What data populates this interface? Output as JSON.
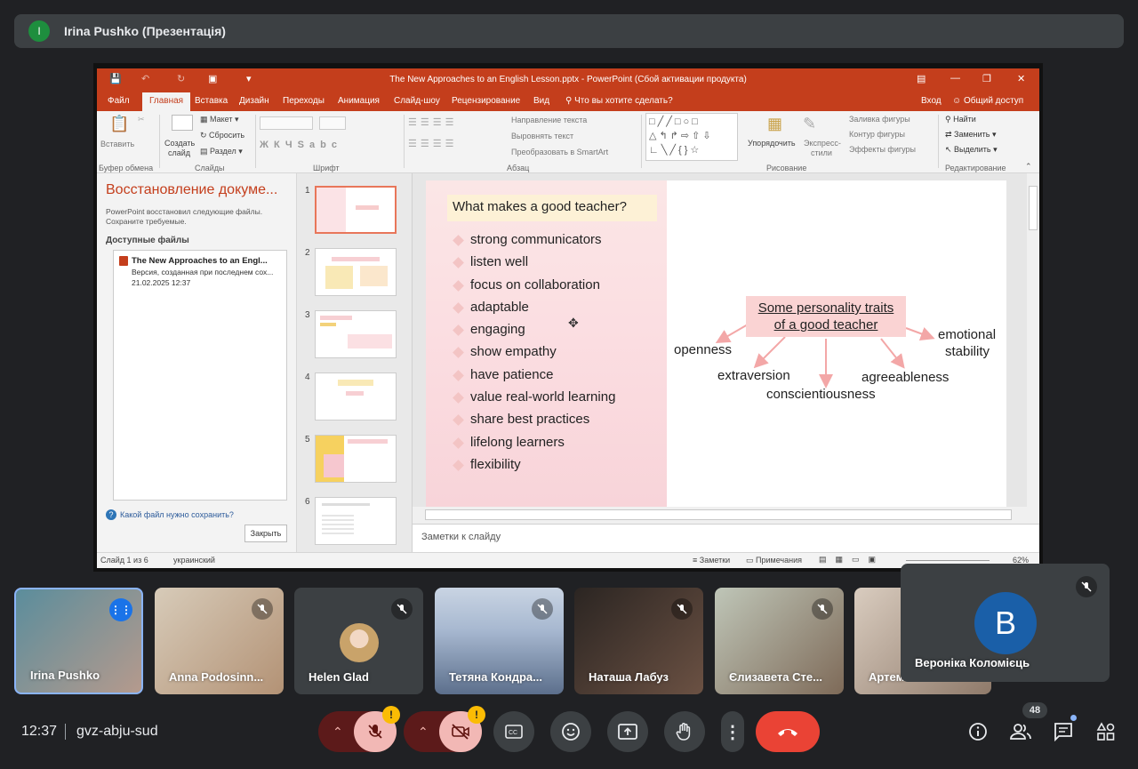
{
  "presenter": {
    "avatar_letter": "I",
    "name": "Irina Pushko (Презентація)"
  },
  "ppt": {
    "window_title": "The New Approaches to an English Lesson.pptx - PowerPoint (Сбой активации продукта)",
    "menu": [
      "Файл",
      "Главная",
      "Вставка",
      "Дизайн",
      "Переходы",
      "Анимация",
      "Слайд-шоу",
      "Рецензирование",
      "Вид"
    ],
    "tell_me": "Что вы хотите сделать?",
    "login": "Вход",
    "share": "Общий доступ",
    "ribbon": {
      "paste": "Вставить",
      "new_slide_1": "Создать",
      "new_slide_2": "слайд",
      "layout": "Макет",
      "reset": "Сбросить",
      "section": "Раздел",
      "text_direction": "Направление текста",
      "align_text": "Выровнять текст",
      "smartart": "Преобразовать в SmartArt",
      "arrange": "Упорядочить",
      "quick_styles_1": "Экспресс-",
      "quick_styles_2": "стили",
      "shape_fill": "Заливка фигуры",
      "shape_outline": "Контур фигуры",
      "shape_effects": "Эффекты фигуры",
      "find": "Найти",
      "replace": "Заменить",
      "select": "Выделить",
      "groups": {
        "clipboard": "Буфер обмена",
        "slides": "Слайды",
        "font": "Шрифт",
        "paragraph": "Абзац",
        "drawing": "Рисование",
        "editing": "Редактирование"
      }
    },
    "recovery": {
      "title": "Восстановление докуме...",
      "desc": "PowerPoint восстановил следующие файлы. Сохраните требуемые.",
      "available": "Доступные файлы",
      "file_title": "The New Approaches to an Engl...",
      "file_sub": "Версия, созданная при последнем сох...",
      "file_date": "21.02.2025 12:37",
      "help": "Какой файл нужно сохранить?",
      "close": "Закрыть"
    },
    "thumbnails": [
      "1",
      "2",
      "3",
      "4",
      "5",
      "6"
    ],
    "slide": {
      "question": "What makes a good teacher?",
      "bullets": [
        "strong communicators",
        "listen well",
        "focus on collaboration",
        "adaptable",
        "engaging",
        "show empathy",
        "have patience",
        "value real-world learning",
        "share best practices",
        "lifelong learners",
        "flexibility"
      ],
      "center_1": "Some personality traits",
      "center_2": "of a good teacher",
      "traits": {
        "openness": "openness",
        "extraversion": "extraversion",
        "conscientiousness": "conscientiousness",
        "agreeableness": "agreeableness",
        "emotional": "emotional",
        "stability": "stability"
      }
    },
    "notes": "Заметки к слайду",
    "status": {
      "slide": "Слайд 1 из 6",
      "language": "украинский",
      "notes": "Заметки",
      "comments": "Примечания",
      "zoom": "62%"
    }
  },
  "participants": [
    {
      "name": "Irina Pushko",
      "speaking": true
    },
    {
      "name": "Anna Podosinn...",
      "muted": true
    },
    {
      "name": "Helen Glad",
      "muted": true
    },
    {
      "name": "Тетяна Кондра...",
      "muted": true
    },
    {
      "name": "Наташа Лабуз",
      "muted": true
    },
    {
      "name": "Єлизавета Сте...",
      "muted": true
    },
    {
      "name": "Артем",
      "muted": true
    }
  ],
  "featured": {
    "letter": "B",
    "name": "Вероніка Коломієць"
  },
  "bottom": {
    "time": "12:37",
    "meeting_code": "gvz-abju-sud",
    "participants_count": "48",
    "warning": "!"
  },
  "colors": {
    "ppt_accent": "#c43e1c",
    "meet_bg": "#202124",
    "end_call": "#ea4335"
  }
}
